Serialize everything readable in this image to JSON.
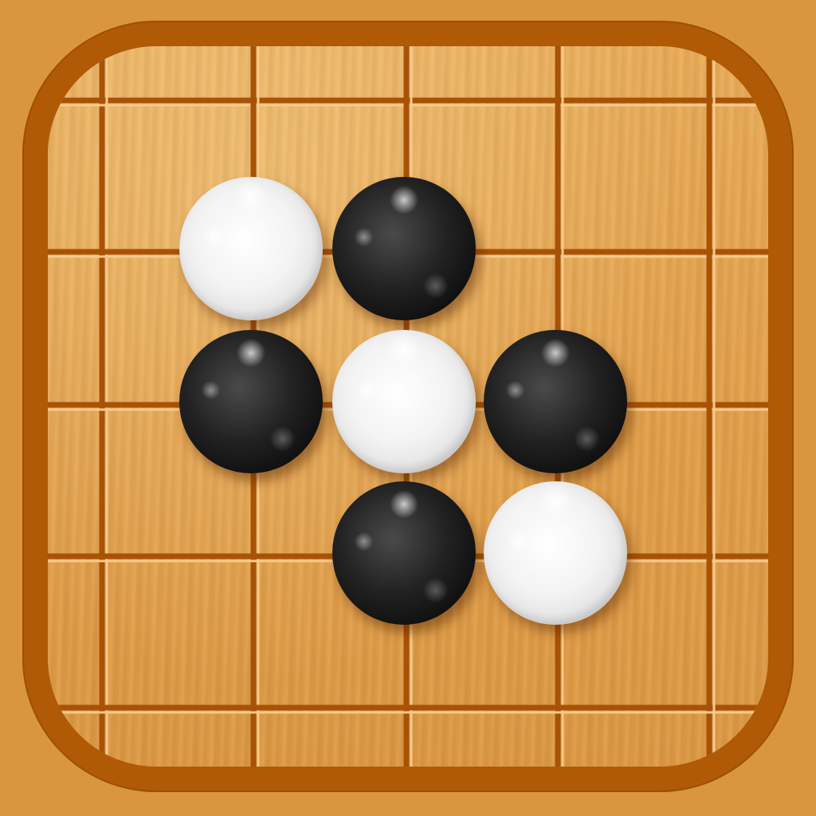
{
  "game": {
    "kind": "gomoku-board-app-icon",
    "colors": {
      "background": "#D9963C",
      "frame": "#B05A06",
      "board_wood": "#E3A04A",
      "grid_line": "#A85208",
      "grid_highlight": "#F7C98A",
      "black_stone": "#111111",
      "white_stone": "#F2F2F2"
    },
    "board": {
      "visible_columns": 5,
      "visible_rows": 5
    },
    "stones": [
      {
        "color": "white",
        "col": 1,
        "row": 1
      },
      {
        "color": "black",
        "col": 2,
        "row": 1
      },
      {
        "color": "black",
        "col": 1,
        "row": 2
      },
      {
        "color": "white",
        "col": 2,
        "row": 2
      },
      {
        "color": "black",
        "col": 3,
        "row": 2
      },
      {
        "color": "black",
        "col": 2,
        "row": 3
      },
      {
        "color": "white",
        "col": 3,
        "row": 3
      }
    ]
  }
}
